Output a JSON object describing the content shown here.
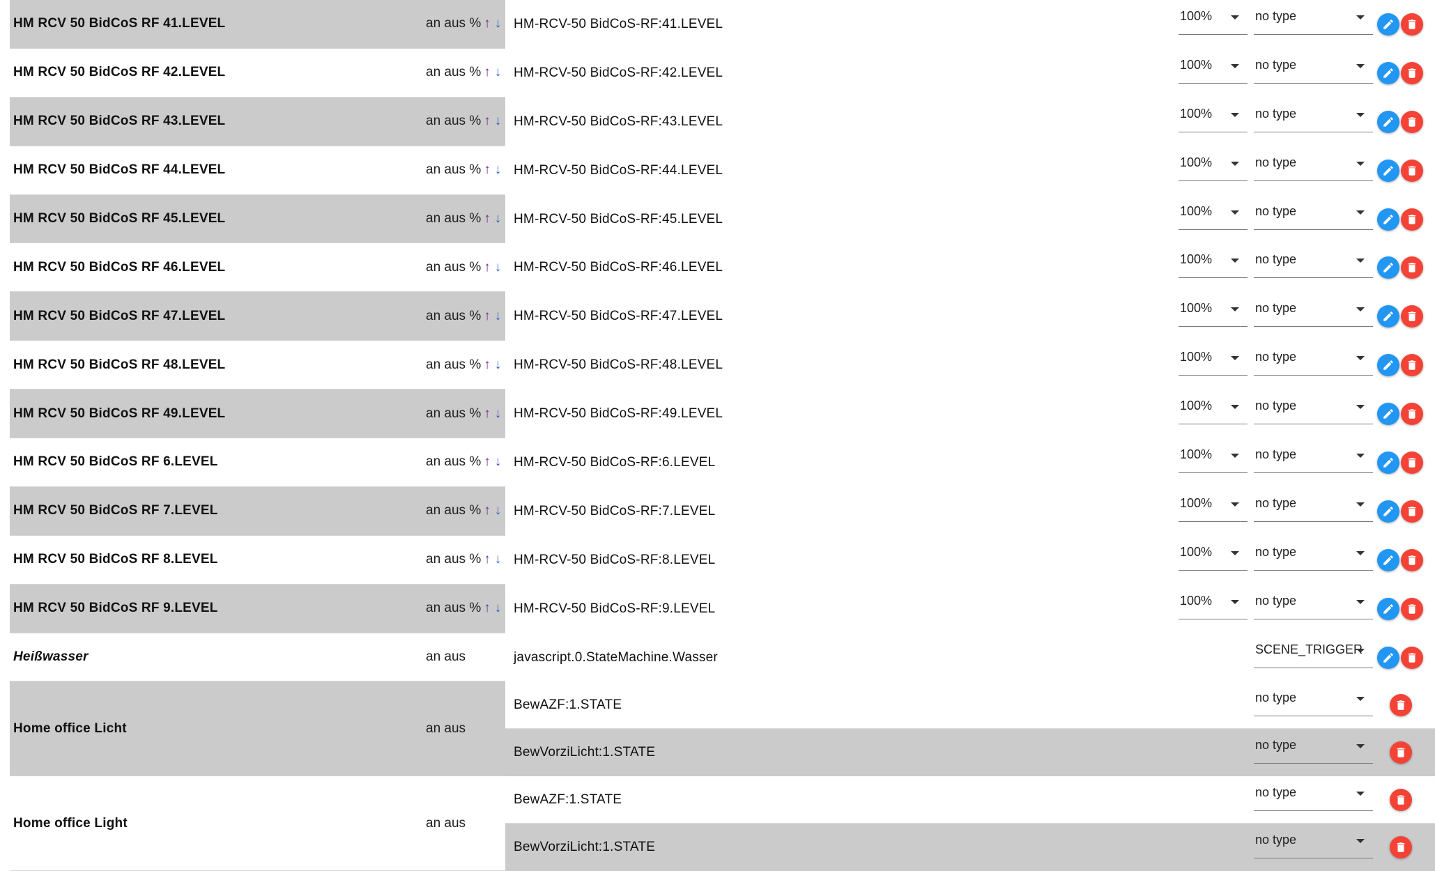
{
  "colors": {
    "row_gray": "#cbcbcb",
    "edit_button": "#2196f3",
    "delete_button": "#f44336",
    "arrow_up": "#6b2d8a",
    "arrow_down": "#2b55b8"
  },
  "icons": {
    "edit": "pencil-icon",
    "delete": "trash-icon",
    "dropdown": "chevron-down-icon"
  },
  "rows": [
    {
      "name": "HM RCV 50 BidCoS RF 41.LEVEL",
      "actions": "an aus %",
      "arrows": [
        "↑",
        "↓"
      ],
      "devices": [
        {
          "id": "HM-RCV-50 BidCoS-RF:41.LEVEL",
          "factor": "100%",
          "type": "no type"
        }
      ]
    },
    {
      "name": "HM RCV 50 BidCoS RF 42.LEVEL",
      "actions": "an aus %",
      "arrows": [
        "↑",
        "↓"
      ],
      "devices": [
        {
          "id": "HM-RCV-50 BidCoS-RF:42.LEVEL",
          "factor": "100%",
          "type": "no type"
        }
      ]
    },
    {
      "name": "HM RCV 50 BidCoS RF 43.LEVEL",
      "actions": "an aus %",
      "arrows": [
        "↑",
        "↓"
      ],
      "devices": [
        {
          "id": "HM-RCV-50 BidCoS-RF:43.LEVEL",
          "factor": "100%",
          "type": "no type"
        }
      ]
    },
    {
      "name": "HM RCV 50 BidCoS RF 44.LEVEL",
      "actions": "an aus %",
      "arrows": [
        "↑",
        "↓"
      ],
      "devices": [
        {
          "id": "HM-RCV-50 BidCoS-RF:44.LEVEL",
          "factor": "100%",
          "type": "no type"
        }
      ]
    },
    {
      "name": "HM RCV 50 BidCoS RF 45.LEVEL",
      "actions": "an aus %",
      "arrows": [
        "↑",
        "↓"
      ],
      "devices": [
        {
          "id": "HM-RCV-50 BidCoS-RF:45.LEVEL",
          "factor": "100%",
          "type": "no type"
        }
      ]
    },
    {
      "name": "HM RCV 50 BidCoS RF 46.LEVEL",
      "actions": "an aus %",
      "arrows": [
        "↑",
        "↓"
      ],
      "devices": [
        {
          "id": "HM-RCV-50 BidCoS-RF:46.LEVEL",
          "factor": "100%",
          "type": "no type"
        }
      ]
    },
    {
      "name": "HM RCV 50 BidCoS RF 47.LEVEL",
      "actions": "an aus %",
      "arrows": [
        "↑",
        "↓"
      ],
      "devices": [
        {
          "id": "HM-RCV-50 BidCoS-RF:47.LEVEL",
          "factor": "100%",
          "type": "no type"
        }
      ]
    },
    {
      "name": "HM RCV 50 BidCoS RF 48.LEVEL",
      "actions": "an aus %",
      "arrows": [
        "↑",
        "↓"
      ],
      "devices": [
        {
          "id": "HM-RCV-50 BidCoS-RF:48.LEVEL",
          "factor": "100%",
          "type": "no type"
        }
      ]
    },
    {
      "name": "HM RCV 50 BidCoS RF 49.LEVEL",
      "actions": "an aus %",
      "arrows": [
        "↑",
        "↓"
      ],
      "devices": [
        {
          "id": "HM-RCV-50 BidCoS-RF:49.LEVEL",
          "factor": "100%",
          "type": "no type"
        }
      ]
    },
    {
      "name": "HM RCV 50 BidCoS RF 6.LEVEL",
      "actions": "an aus %",
      "arrows": [
        "↑",
        "↓"
      ],
      "devices": [
        {
          "id": "HM-RCV-50 BidCoS-RF:6.LEVEL",
          "factor": "100%",
          "type": "no type"
        }
      ]
    },
    {
      "name": "HM RCV 50 BidCoS RF 7.LEVEL",
      "actions": "an aus %",
      "arrows": [
        "↑",
        "↓"
      ],
      "devices": [
        {
          "id": "HM-RCV-50 BidCoS-RF:7.LEVEL",
          "factor": "100%",
          "type": "no type"
        }
      ]
    },
    {
      "name": "HM RCV 50 BidCoS RF 8.LEVEL",
      "actions": "an aus %",
      "arrows": [
        "↑",
        "↓"
      ],
      "devices": [
        {
          "id": "HM-RCV-50 BidCoS-RF:8.LEVEL",
          "factor": "100%",
          "type": "no type"
        }
      ]
    },
    {
      "name": "HM RCV 50 BidCoS RF 9.LEVEL",
      "actions": "an aus %",
      "arrows": [
        "↑",
        "↓"
      ],
      "devices": [
        {
          "id": "HM-RCV-50 BidCoS-RF:9.LEVEL",
          "factor": "100%",
          "type": "no type"
        }
      ]
    },
    {
      "name": "Heißwasser",
      "italic": true,
      "actions": "an aus",
      "arrows": [],
      "devices": [
        {
          "id": "javascript.0.StateMachine.Wasser",
          "type": "SCENE_TRIGGER"
        }
      ]
    },
    {
      "name": "Home office Licht",
      "actions": "an aus",
      "arrows": [],
      "devices": [
        {
          "id": "BewAZF:1.STATE",
          "type": "no type",
          "delete_only": true
        },
        {
          "id": "BewVorziLicht:1.STATE",
          "type": "no type",
          "delete_only": true
        }
      ]
    },
    {
      "name": "Home office Light",
      "actions": "an aus",
      "arrows": [],
      "devices": [
        {
          "id": "BewAZF:1.STATE",
          "type": "no type",
          "delete_only": true
        },
        {
          "id": "BewVorziLicht:1.STATE",
          "type": "no type",
          "delete_only": true
        }
      ]
    }
  ]
}
